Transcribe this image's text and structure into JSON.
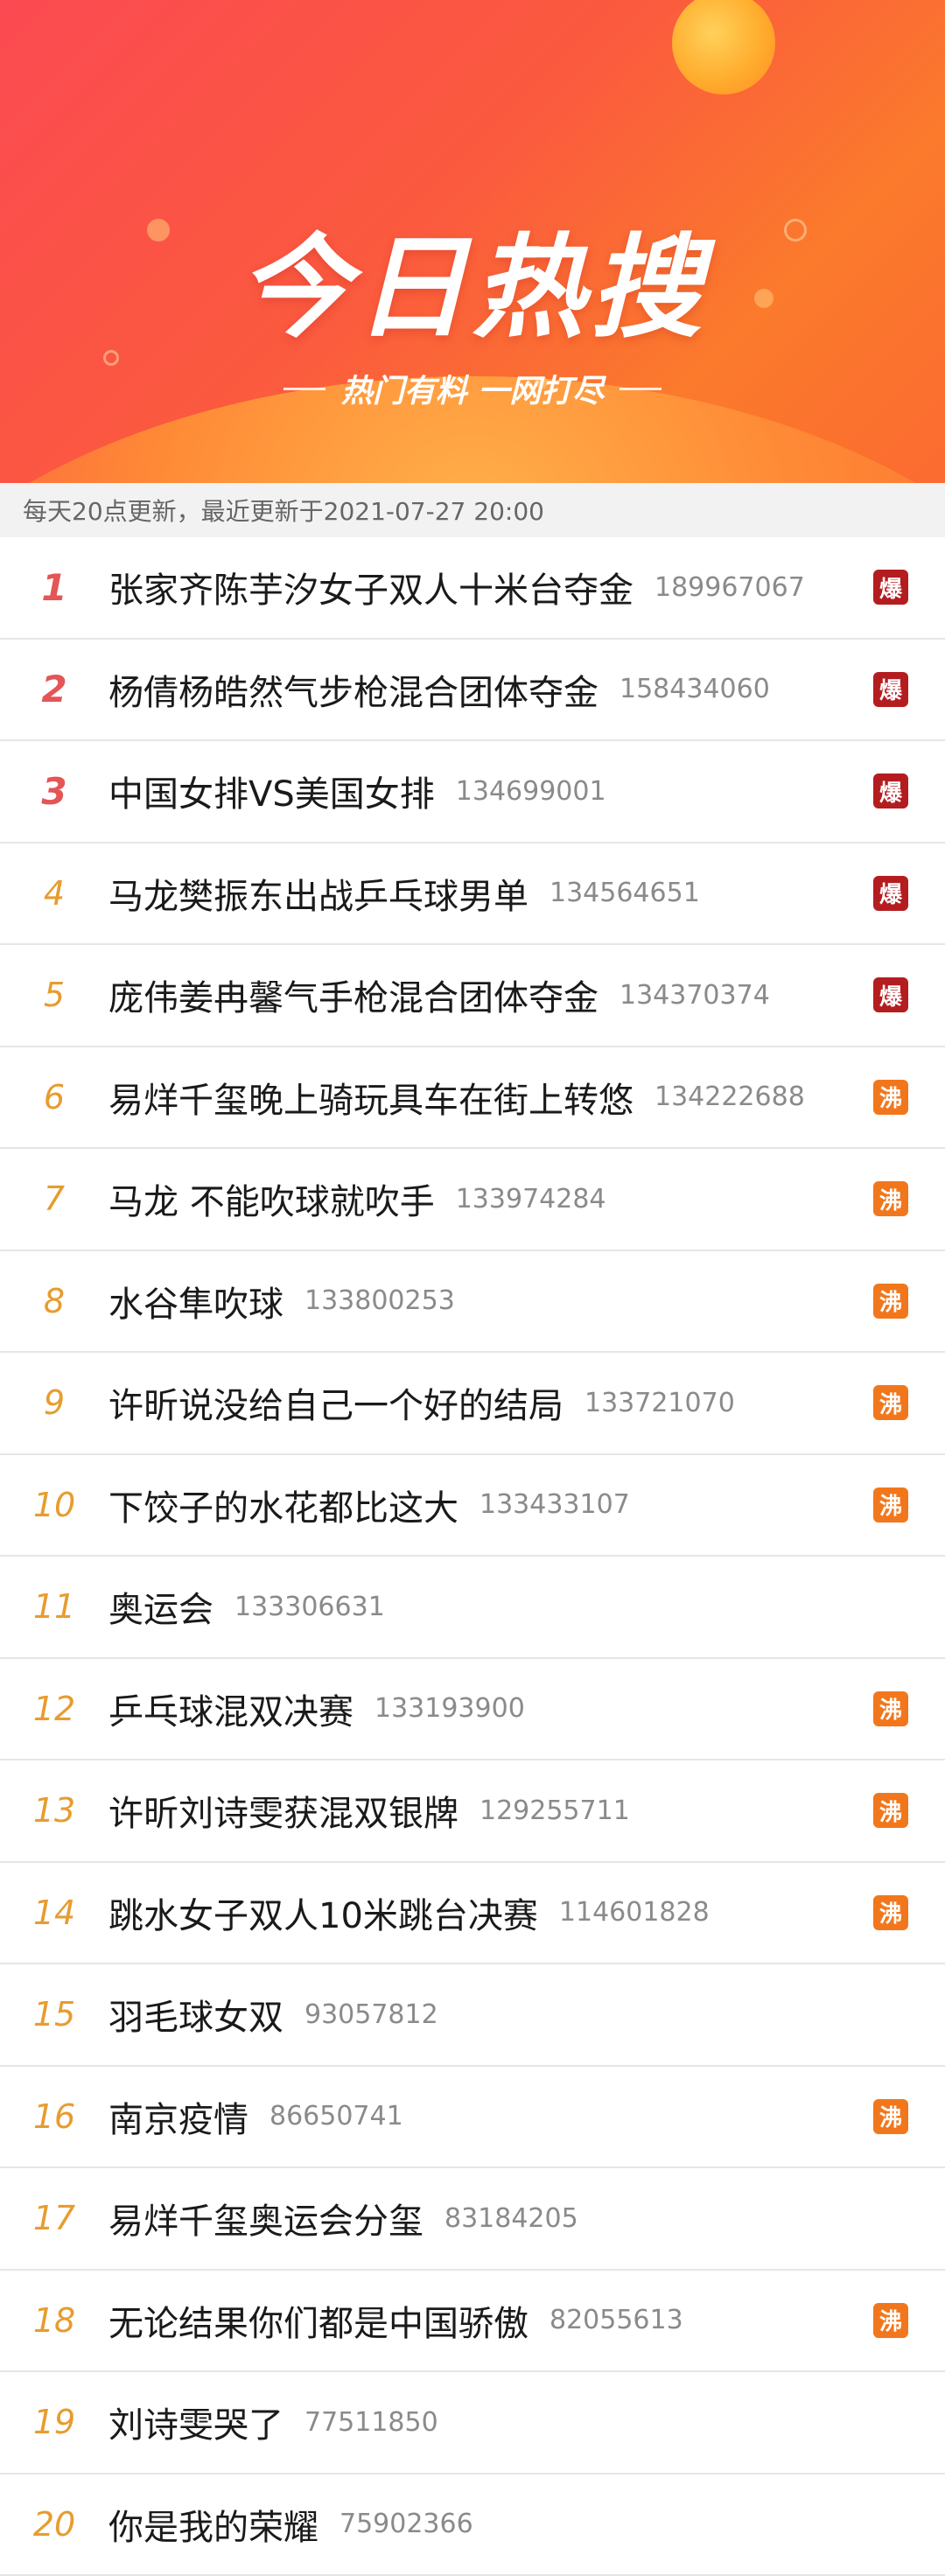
{
  "banner": {
    "title": "今日热搜",
    "subtitle": "热门有料 一网打尽"
  },
  "update_text": "每天20点更新，最近更新于2021-07-27 20:00",
  "colors": {
    "rank_top": "#e45556",
    "rank_other": "#e79c2f",
    "tag_bao": "#b41d20",
    "tag_fei": "#f2771c"
  },
  "items": [
    {
      "rank": "1",
      "topic": "张家齐陈芋汐女子双人十米台夺金",
      "count": "189967067",
      "tag": "爆",
      "tag_type": "bao"
    },
    {
      "rank": "2",
      "topic": "杨倩杨皓然气步枪混合团体夺金",
      "count": "158434060",
      "tag": "爆",
      "tag_type": "bao"
    },
    {
      "rank": "3",
      "topic": "中国女排VS美国女排",
      "count": "134699001",
      "tag": "爆",
      "tag_type": "bao"
    },
    {
      "rank": "4",
      "topic": "马龙樊振东出战乒乓球男单",
      "count": "134564651",
      "tag": "爆",
      "tag_type": "bao"
    },
    {
      "rank": "5",
      "topic": "庞伟姜冉馨气手枪混合团体夺金",
      "count": "134370374",
      "tag": "爆",
      "tag_type": "bao"
    },
    {
      "rank": "6",
      "topic": "易烊千玺晚上骑玩具车在街上转悠",
      "count": "134222688",
      "tag": "沸",
      "tag_type": "fei"
    },
    {
      "rank": "7",
      "topic": "马龙 不能吹球就吹手",
      "count": "133974284",
      "tag": "沸",
      "tag_type": "fei"
    },
    {
      "rank": "8",
      "topic": "水谷隼吹球",
      "count": "133800253",
      "tag": "沸",
      "tag_type": "fei"
    },
    {
      "rank": "9",
      "topic": "许昕说没给自己一个好的结局",
      "count": "133721070",
      "tag": "沸",
      "tag_type": "fei"
    },
    {
      "rank": "10",
      "topic": "下饺子的水花都比这大",
      "count": "133433107",
      "tag": "沸",
      "tag_type": "fei"
    },
    {
      "rank": "11",
      "topic": "奥运会",
      "count": "133306631",
      "tag": "",
      "tag_type": ""
    },
    {
      "rank": "12",
      "topic": "乒乓球混双决赛",
      "count": "133193900",
      "tag": "沸",
      "tag_type": "fei"
    },
    {
      "rank": "13",
      "topic": "许昕刘诗雯获混双银牌",
      "count": "129255711",
      "tag": "沸",
      "tag_type": "fei"
    },
    {
      "rank": "14",
      "topic": "跳水女子双人10米跳台决赛",
      "count": "114601828",
      "tag": "沸",
      "tag_type": "fei"
    },
    {
      "rank": "15",
      "topic": "羽毛球女双",
      "count": "93057812",
      "tag": "",
      "tag_type": ""
    },
    {
      "rank": "16",
      "topic": "南京疫情",
      "count": "86650741",
      "tag": "沸",
      "tag_type": "fei"
    },
    {
      "rank": "17",
      "topic": "易烊千玺奥运会分玺",
      "count": "83184205",
      "tag": "",
      "tag_type": ""
    },
    {
      "rank": "18",
      "topic": "无论结果你们都是中国骄傲",
      "count": "82055613",
      "tag": "沸",
      "tag_type": "fei"
    },
    {
      "rank": "19",
      "topic": "刘诗雯哭了",
      "count": "77511850",
      "tag": "",
      "tag_type": ""
    },
    {
      "rank": "20",
      "topic": "你是我的荣耀",
      "count": "75902366",
      "tag": "",
      "tag_type": ""
    }
  ]
}
